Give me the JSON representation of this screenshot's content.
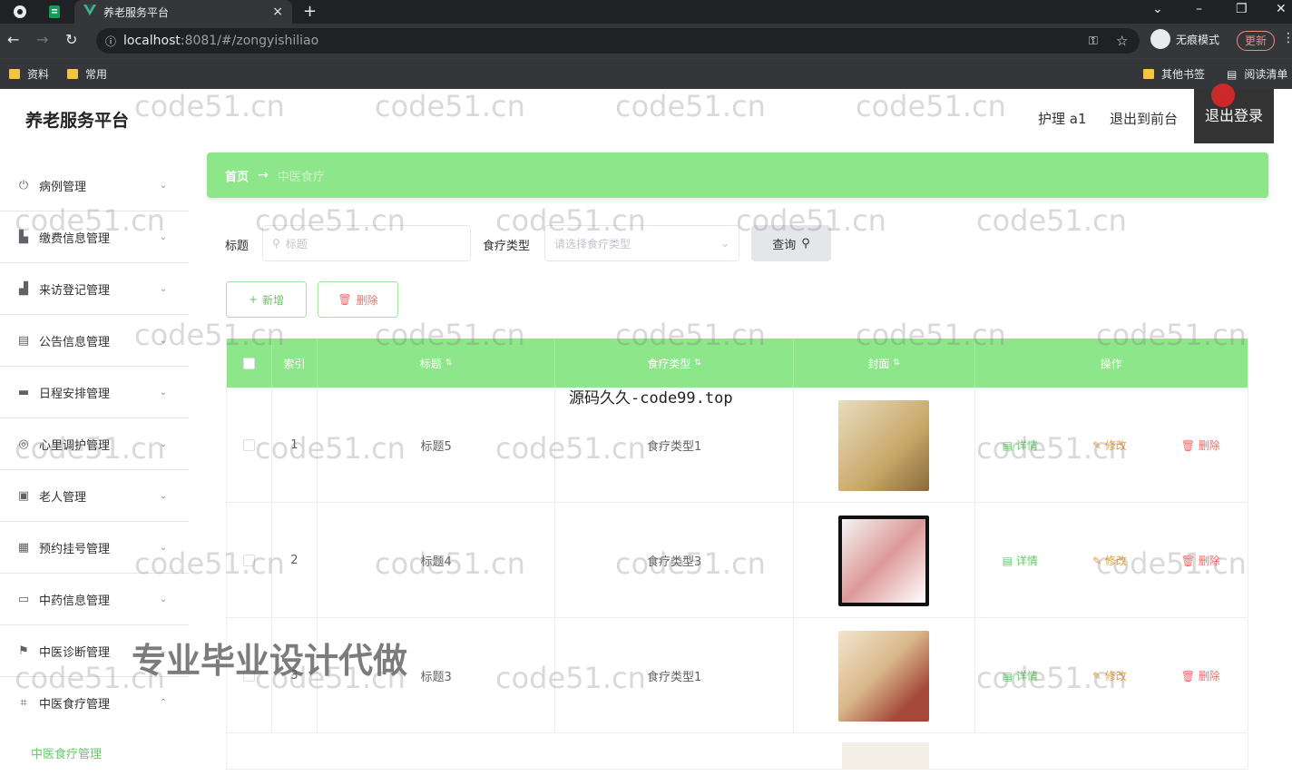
{
  "browser": {
    "tab_title": "养老服务平台",
    "tab_close": "×",
    "new_tab": "+",
    "url_host": "localhost",
    "url_path": ":8081/#/zongyishiliao",
    "incognito_label": "无痕模式",
    "update_label": "更新",
    "bookmarks": [
      "资料",
      "常用"
    ],
    "other_bookmarks": "其他书签",
    "reading_list": "阅读清单"
  },
  "header": {
    "logo": "养老服务平台",
    "user": "护理 a1",
    "to_front": "退出到前台",
    "logout": "退出登录"
  },
  "sidebar": {
    "items": [
      {
        "label": "病例管理",
        "icon": "power-icon"
      },
      {
        "label": "缴费信息管理",
        "icon": "chart-icon"
      },
      {
        "label": "来访登记管理",
        "icon": "bar-chart-icon"
      },
      {
        "label": "公告信息管理",
        "icon": "clipboard-icon"
      },
      {
        "label": "日程安排管理",
        "icon": "briefcase-icon"
      },
      {
        "label": "心里调护管理",
        "icon": "help-icon"
      },
      {
        "label": "老人管理",
        "icon": "document-icon"
      },
      {
        "label": "预约挂号管理",
        "icon": "grid-icon"
      },
      {
        "label": "中药信息管理",
        "icon": "card-icon"
      },
      {
        "label": "中医诊断管理",
        "icon": "flag-icon"
      },
      {
        "label": "中医食疗管理",
        "icon": "crop-icon"
      }
    ],
    "active_sub": "中医食疗管理"
  },
  "main": {
    "breadcrumb_home": "首页",
    "breadcrumb_arrow": "→",
    "breadcrumb_current": "中医食疗",
    "search": {
      "title_label": "标题",
      "title_placeholder": "标题",
      "type_label": "食疗类型",
      "type_placeholder": "请选择食疗类型",
      "query": "查询"
    },
    "add": "新增",
    "delete": "删除",
    "columns": [
      "索引",
      "标题",
      "食疗类型",
      "封面",
      "操作"
    ],
    "rows": [
      {
        "index": "1",
        "title": "标题5",
        "type": "食疗类型1"
      },
      {
        "index": "2",
        "title": "标题4",
        "type": "食疗类型3"
      },
      {
        "index": "3",
        "title": "标题3",
        "type": "食疗类型1"
      }
    ],
    "op_detail": "详情",
    "op_edit": "修改",
    "op_delete": "删除"
  },
  "overlay": {
    "watermark": "code51.cn",
    "source_text": "源码久久-code99.top",
    "ad_text": "专业毕业设计代做"
  }
}
